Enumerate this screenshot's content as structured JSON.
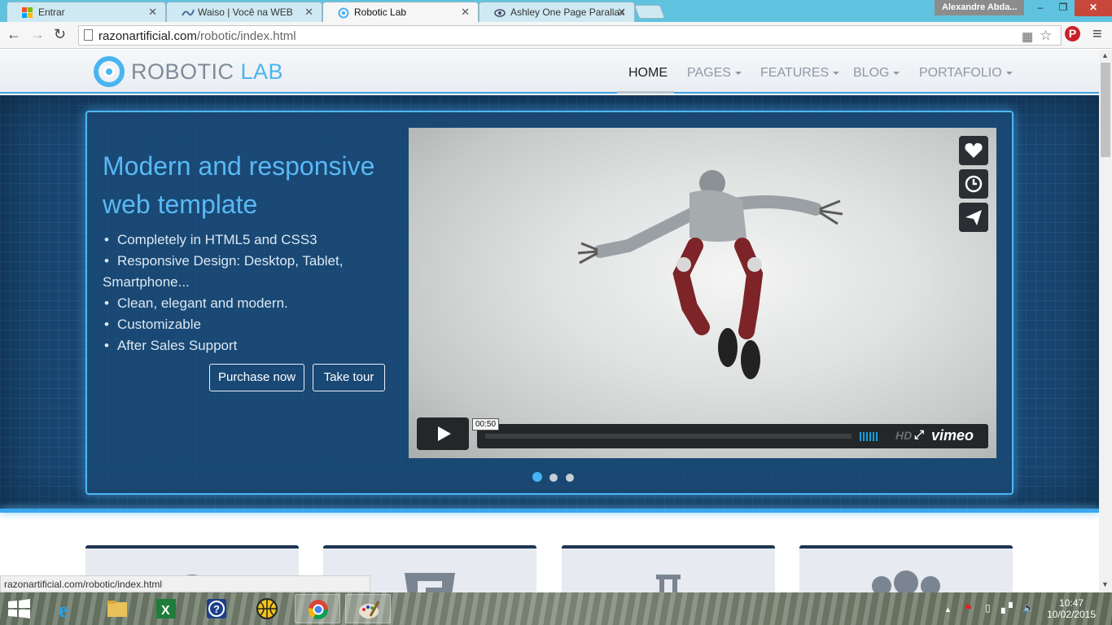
{
  "browser": {
    "tabs": [
      {
        "title": "Entrar",
        "icon": "windows-live-icon"
      },
      {
        "title": "Waiso | Você na WEB",
        "icon": "waiso-icon"
      },
      {
        "title": "Robotic Lab",
        "icon": "robotic-lab-icon",
        "active": true
      },
      {
        "title": "Ashley One Page Parallax",
        "icon": "eye-icon"
      }
    ],
    "user_name": "Alexandre Abda...",
    "url_domain": "razonartificial.com",
    "url_path": "/robotic/index.html",
    "status_url": "razonartificial.com/robotic/index.html"
  },
  "site": {
    "logo_word1": "ROBOTIC",
    "logo_word2": "LAB",
    "nav": [
      {
        "label": "HOME",
        "active": true
      },
      {
        "label": "PAGES",
        "dropdown": true
      },
      {
        "label": "FEATURES",
        "dropdown": true
      },
      {
        "label": "BLOG",
        "dropdown": true
      },
      {
        "label": "PORTAFOLIO",
        "dropdown": true
      }
    ]
  },
  "hero": {
    "title": "Modern and responsive web template",
    "bullets": [
      "Completely in HTML5 and CSS3",
      "Responsive Design: Desktop, Tablet, Smartphone...",
      "Clean, elegant and modern.",
      "Customizable",
      "After Sales Support"
    ],
    "buttons": {
      "purchase": "Purchase now",
      "tour": "Take tour"
    },
    "video": {
      "time": "00:50",
      "hd_label": "HD",
      "brand": "vimeo",
      "side_icons": [
        "heart-icon",
        "clock-icon",
        "send-icon"
      ]
    },
    "slides": 3,
    "active_slide": 1
  },
  "features": {
    "cards": [
      "user-icon",
      "html5-icon",
      "column-icon",
      "group-icon"
    ]
  },
  "taskbar": {
    "apps": [
      "internet-explorer-icon",
      "file-explorer-icon",
      "excel-icon",
      "help-icon",
      "globe-icon",
      "chrome-icon",
      "paint-icon"
    ],
    "time": "10:47",
    "date": "10/02/2015"
  },
  "colors": {
    "accent": "#48b5f0",
    "hero_bg": "#18456f",
    "card_top": "#1f3551"
  }
}
